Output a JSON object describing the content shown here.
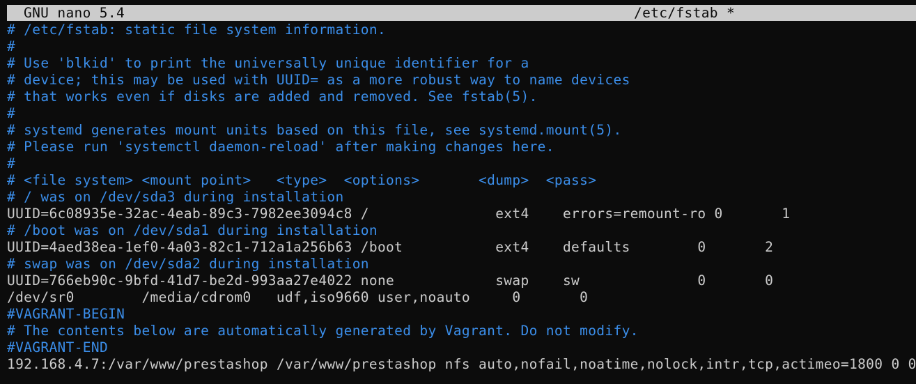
{
  "titlebar": {
    "app": "GNU nano 5.4",
    "filename": "/etc/fstab *"
  },
  "colors": {
    "background": "#0c0c0c",
    "text": "#cccccc",
    "comment": "#3b8eea",
    "titlebar_bg": "#cccccc",
    "titlebar_fg": "#0c0c0c"
  },
  "lines": [
    {
      "text": "# /etc/fstab: static file system information.",
      "kind": "comment"
    },
    {
      "text": "#",
      "kind": "comment"
    },
    {
      "text": "# Use 'blkid' to print the universally unique identifier for a",
      "kind": "comment"
    },
    {
      "text": "# device; this may be used with UUID= as a more robust way to name devices",
      "kind": "comment"
    },
    {
      "text": "# that works even if disks are added and removed. See fstab(5).",
      "kind": "comment"
    },
    {
      "text": "#",
      "kind": "comment"
    },
    {
      "text": "# systemd generates mount units based on this file, see systemd.mount(5).",
      "kind": "comment"
    },
    {
      "text": "# Please run 'systemctl daemon-reload' after making changes here.",
      "kind": "comment"
    },
    {
      "text": "#",
      "kind": "comment"
    },
    {
      "text": "# <file system> <mount point>   <type>  <options>       <dump>  <pass>",
      "kind": "comment"
    },
    {
      "text": "# / was on /dev/sda3 during installation",
      "kind": "comment"
    },
    {
      "text": "UUID=6c08935e-32ac-4eab-89c3-7982ee3094c8 /               ext4    errors=remount-ro 0       1",
      "kind": "plain"
    },
    {
      "text": "# /boot was on /dev/sda1 during installation",
      "kind": "comment"
    },
    {
      "text": "UUID=4aed38ea-1ef0-4a03-82c1-712a1a256b63 /boot           ext4    defaults        0       2",
      "kind": "plain"
    },
    {
      "text": "# swap was on /dev/sda2 during installation",
      "kind": "comment"
    },
    {
      "text": "UUID=766eb90c-9bfd-41d7-be2d-993aa27e4022 none            swap    sw              0       0",
      "kind": "plain"
    },
    {
      "text": "/dev/sr0        /media/cdrom0   udf,iso9660 user,noauto     0       0",
      "kind": "plain"
    },
    {
      "text": "#VAGRANT-BEGIN",
      "kind": "comment"
    },
    {
      "text": "# The contents below are automatically generated by Vagrant. Do not modify.",
      "kind": "comment"
    },
    {
      "text": "#VAGRANT-END",
      "kind": "comment"
    },
    {
      "text": "192.168.4.7:/var/www/prestashop /var/www/prestashop nfs auto,nofail,noatime,nolock,intr,tcp,actimeo=1800 0 0",
      "kind": "plain"
    }
  ]
}
